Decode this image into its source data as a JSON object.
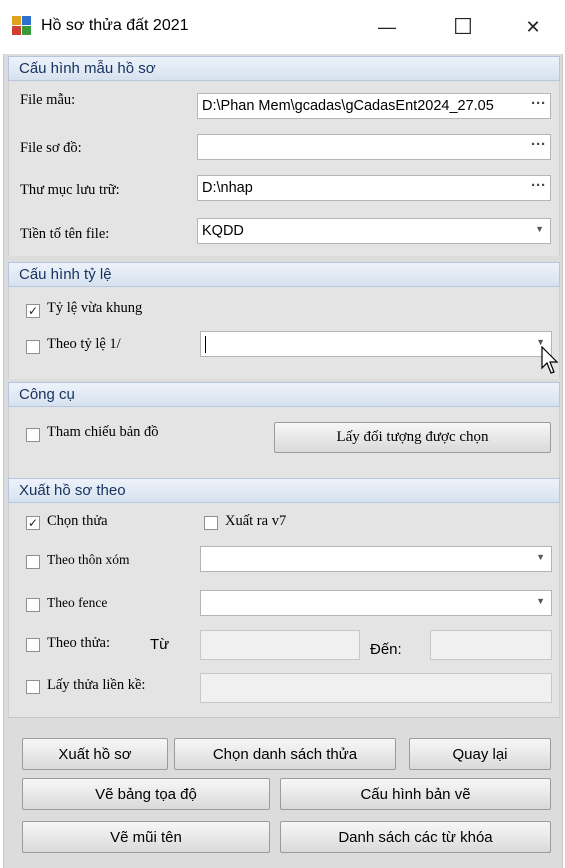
{
  "window": {
    "title": "Hồ sơ thửa đất 2021",
    "minimize_glyph": "—",
    "maximize_glyph": "☐",
    "close_glyph": "✕"
  },
  "template_config": {
    "header": "Cấu hình mẫu hồ sơ",
    "template_file_label": "File mẫu:",
    "template_file_value": "D:\\Phan Mem\\gcadas\\gCadasEnt2024_27.05",
    "diagram_file_label": "File sơ đồ:",
    "diagram_file_value": "",
    "storage_folder_label": "Thư mục lưu trữ:",
    "storage_folder_value": "D:\\nhap",
    "file_prefix_label": "Tiền tố tên file:",
    "file_prefix_value": "KQDD",
    "browse_glyph": "···"
  },
  "scale_config": {
    "header": "Cấu hình tỷ lệ",
    "fit_frame_label": "Tỷ lệ vừa khung",
    "fit_frame_checked": true,
    "custom_scale_label": "Theo tỷ lệ 1/",
    "custom_scale_checked": false,
    "custom_scale_value": ""
  },
  "tools": {
    "header": "Công cụ",
    "map_reference_label": "Tham chiếu bản đồ",
    "map_reference_checked": false,
    "get_selected_button": "Lấy đối tượng được chọn"
  },
  "export_by": {
    "header": "Xuất hồ sơ theo",
    "select_parcel_label": "Chọn thửa",
    "select_parcel_checked": true,
    "export_v7_label": "Xuất ra v7",
    "export_v7_checked": false,
    "by_hamlet_label": "Theo thôn xóm",
    "by_hamlet_checked": false,
    "by_fence_label": "Theo fence",
    "by_fence_checked": false,
    "by_parcel_label": "Theo thửa:",
    "by_parcel_checked": false,
    "from_label": "Từ",
    "to_label": "Đến:",
    "adjacent_label": "Lấy thửa liền kề:",
    "adjacent_checked": false
  },
  "actions": {
    "export_button": "Xuất hồ sơ",
    "choose_parcel_list_button": "Chọn danh sách thửa",
    "back_button": "Quay lại",
    "draw_coordinates_button": "Vẽ bảng tọa độ",
    "drawing_config_button": "Cấu hình bản vẽ",
    "draw_arrow_button": "Vẽ mũi tên",
    "keywords_list_button": "Danh sách các từ khóa"
  },
  "check_glyph": "✓",
  "dropdown_glyph": "▼"
}
